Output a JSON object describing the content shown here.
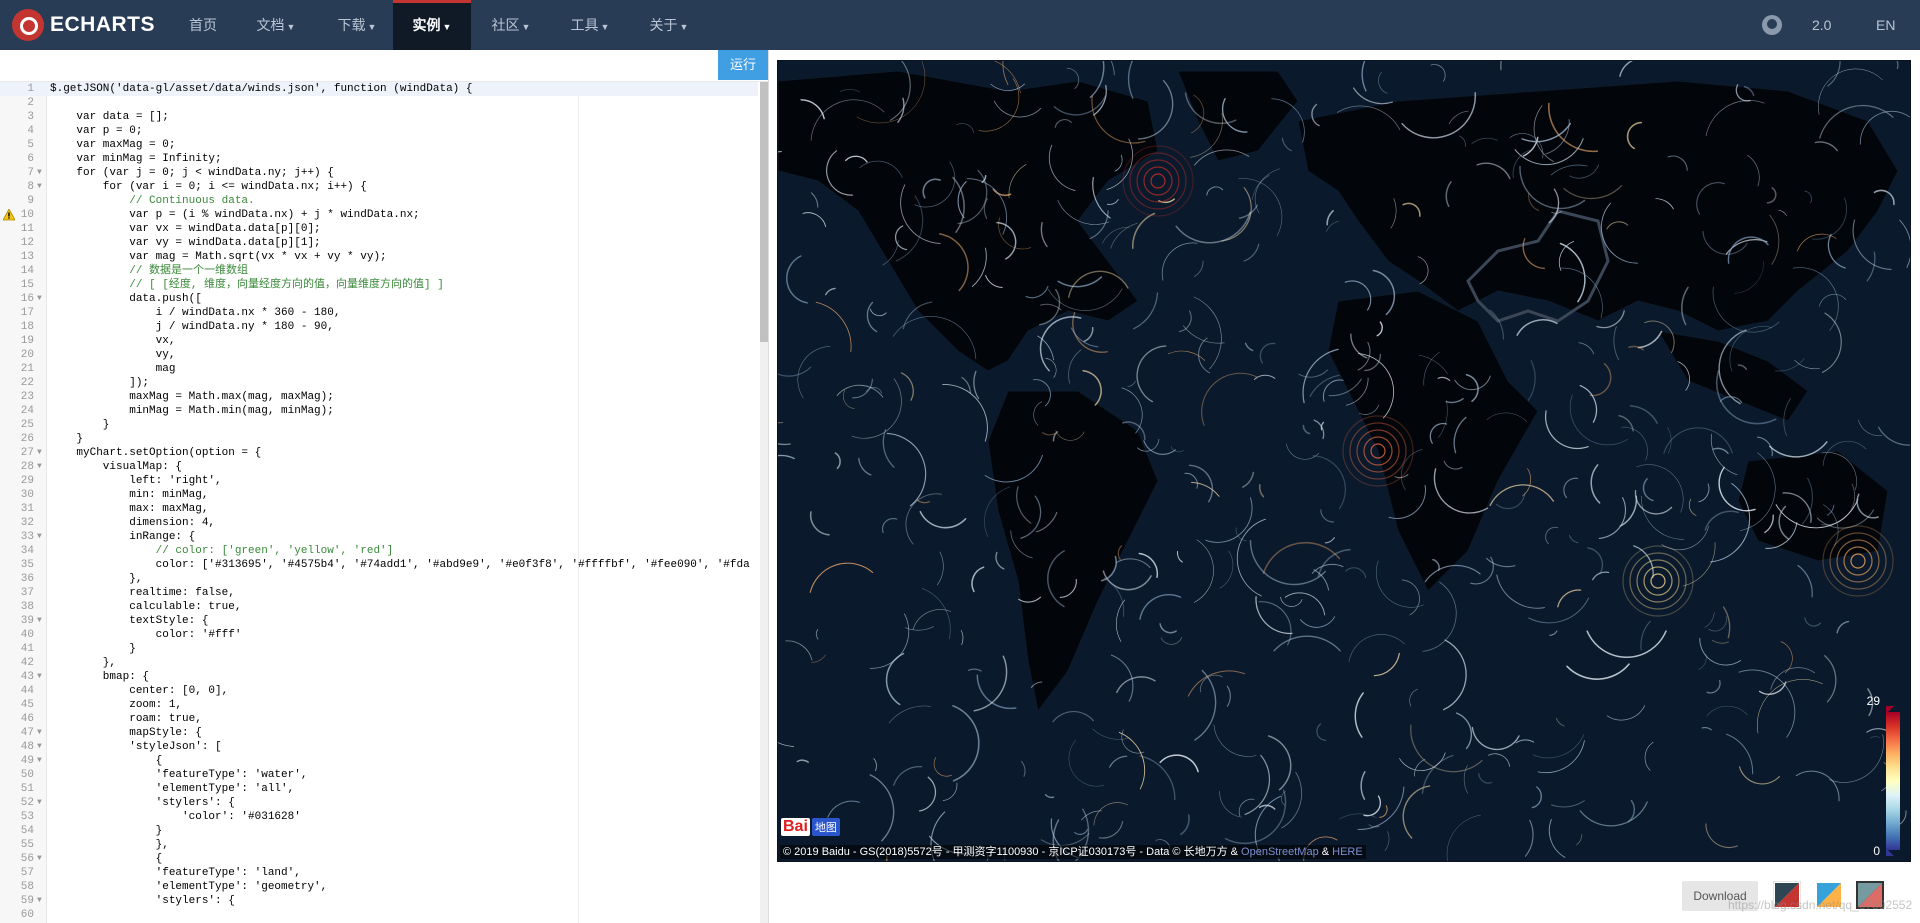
{
  "nav": {
    "logo_text": "ECHARTS",
    "items": [
      {
        "label": "首页",
        "dropdown": false
      },
      {
        "label": "文档",
        "dropdown": true
      },
      {
        "label": "下载",
        "dropdown": true
      },
      {
        "label": "实例",
        "dropdown": true,
        "active": true
      },
      {
        "label": "社区",
        "dropdown": true
      },
      {
        "label": "工具",
        "dropdown": true
      },
      {
        "label": "关于",
        "dropdown": true
      }
    ],
    "github_icon": "github-icon",
    "version": "2.0",
    "lang": "EN"
  },
  "editor": {
    "run_label": "运行",
    "current_line": 1,
    "warning_line": 10,
    "fold_lines": [
      7,
      8,
      16,
      27,
      28,
      33,
      39,
      43,
      47,
      48,
      49,
      52,
      56,
      59
    ],
    "lines": [
      "$.getJSON('data-gl/asset/data/winds.json', function (windData) {",
      "",
      "    var data = [];",
      "    var p = 0;",
      "    var maxMag = 0;",
      "    var minMag = Infinity;",
      "    for (var j = 0; j < windData.ny; j++) {",
      "        for (var i = 0; i <= windData.nx; i++) {",
      "            // Continuous data.",
      "            var p = (i % windData.nx) + j * windData.nx;",
      "            var vx = windData.data[p][0];",
      "            var vy = windData.data[p][1];",
      "            var mag = Math.sqrt(vx * vx + vy * vy);",
      "            // 数据是一个一维数组",
      "            // [ [经度, 维度，向量经度方向的值，向量维度方向的值] ]",
      "            data.push([",
      "                i / windData.nx * 360 - 180,",
      "                j / windData.ny * 180 - 90,",
      "                vx,",
      "                vy,",
      "                mag",
      "            ]);",
      "            maxMag = Math.max(mag, maxMag);",
      "            minMag = Math.min(mag, minMag);",
      "        }",
      "    }",
      "    myChart.setOption(option = {",
      "        visualMap: {",
      "            left: 'right',",
      "            min: minMag,",
      "            max: maxMag,",
      "            dimension: 4,",
      "            inRange: {",
      "                // color: ['green', 'yellow', 'red']",
      "                color: ['#313695', '#4575b4', '#74add1', '#abd9e9', '#e0f3f8', '#ffffbf', '#fee090', '#fda",
      "            },",
      "            realtime: false,",
      "            calculable: true,",
      "            textStyle: {",
      "                color: '#fff'",
      "            }",
      "        },",
      "        bmap: {",
      "            center: [0, 0],",
      "            zoom: 1,",
      "            roam: true,",
      "            mapStyle: {",
      "            'styleJson': [",
      "                {",
      "                'featureType': 'water',",
      "                'elementType': 'all',",
      "                'stylers': {",
      "                    'color': '#031628'",
      "                }",
      "                },",
      "                {",
      "                'featureType': 'land',",
      "                'elementType': 'geometry',",
      "                'stylers': {",
      ""
    ]
  },
  "chart": {
    "visual_map": {
      "max_label": "29",
      "min_label": "0",
      "colors": [
        "#313695",
        "#4575b4",
        "#74add1",
        "#abd9e9",
        "#e0f3f8",
        "#ffffbf",
        "#fee090",
        "#fdae61",
        "#f46d43",
        "#d73027",
        "#a50026"
      ]
    },
    "water_color": "#031628",
    "land_color": "#000000",
    "baidu_logo_text": "Bai",
    "baidu_logo_sub": "地图",
    "attribution_text": "© 2019 Baidu - GS(2018)5572号 - 甲测资字1100930 - 京ICP证030173号 - Data © 长地万方 & ",
    "attribution_link1": "OpenStreetMap",
    "attribution_amp": " & ",
    "attribution_link2": "HERE"
  },
  "toolbar": {
    "download_label": "Download",
    "themes": [
      "theme-default",
      "theme-light",
      "theme-dark"
    ]
  },
  "watermark": "https://blog.csdn.net/qq_37592552"
}
